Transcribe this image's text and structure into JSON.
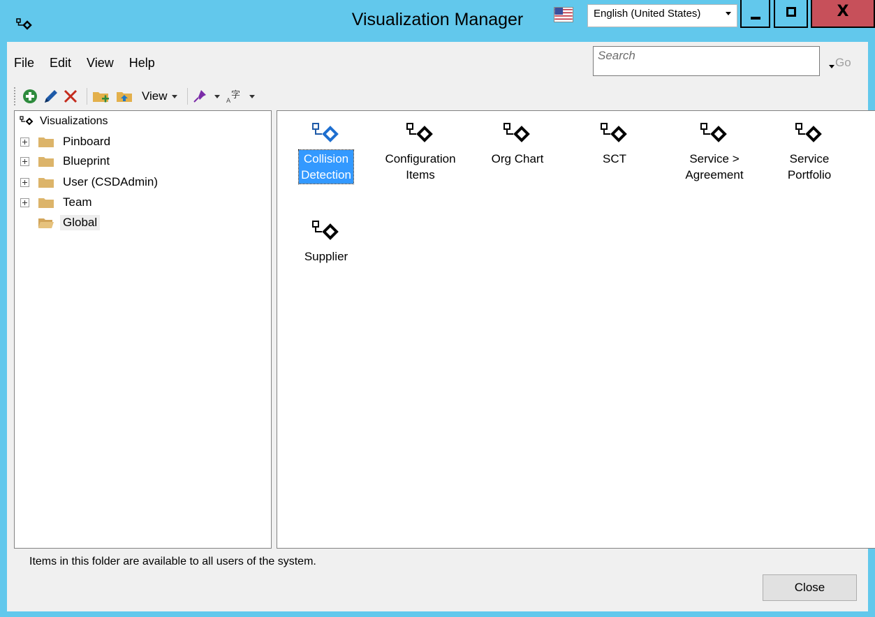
{
  "window": {
    "title": "Visualization Manager",
    "app_icon": "visualization-icon",
    "language": "English (United States)",
    "flag_icon": "us-flag-icon",
    "close_glyph": "X",
    "accent_color": "#62c8ec",
    "close_color": "#c7505a"
  },
  "menu": {
    "items": [
      {
        "label": "File"
      },
      {
        "label": "Edit"
      },
      {
        "label": "View"
      },
      {
        "label": "Help"
      }
    ]
  },
  "search": {
    "placeholder": "Search",
    "go_label": "Go"
  },
  "toolbar": {
    "view_label": "View",
    "buttons": [
      "add-icon",
      "edit-icon",
      "delete-icon",
      "new-folder-icon",
      "move-folder-icon",
      "pin-icon",
      "language-icon"
    ]
  },
  "tree": {
    "root_label": "Visualizations",
    "items": [
      {
        "label": "Pinboard",
        "expandable": true
      },
      {
        "label": "Blueprint",
        "expandable": true
      },
      {
        "label": "User (CSDAdmin)",
        "expandable": true
      },
      {
        "label": "Team",
        "expandable": true
      },
      {
        "label": "Global",
        "expandable": false,
        "selected": true
      }
    ]
  },
  "visualizations": [
    {
      "line1": "Collision",
      "line2": "Detection",
      "selected": true
    },
    {
      "line1": "Configuration",
      "line2": "Items",
      "selected": false
    },
    {
      "line1": "Org Chart",
      "line2": "",
      "selected": false
    },
    {
      "line1": "SCT",
      "line2": "",
      "selected": false
    },
    {
      "line1": "Service >",
      "line2": "Agreement",
      "selected": false
    },
    {
      "line1": "Service",
      "line2": "Portfolio",
      "selected": false
    },
    {
      "line1": "Supplier",
      "line2": "",
      "selected": false
    }
  ],
  "status": {
    "text": "Items in this folder are available to all users of the system."
  },
  "footer": {
    "close_label": "Close"
  }
}
